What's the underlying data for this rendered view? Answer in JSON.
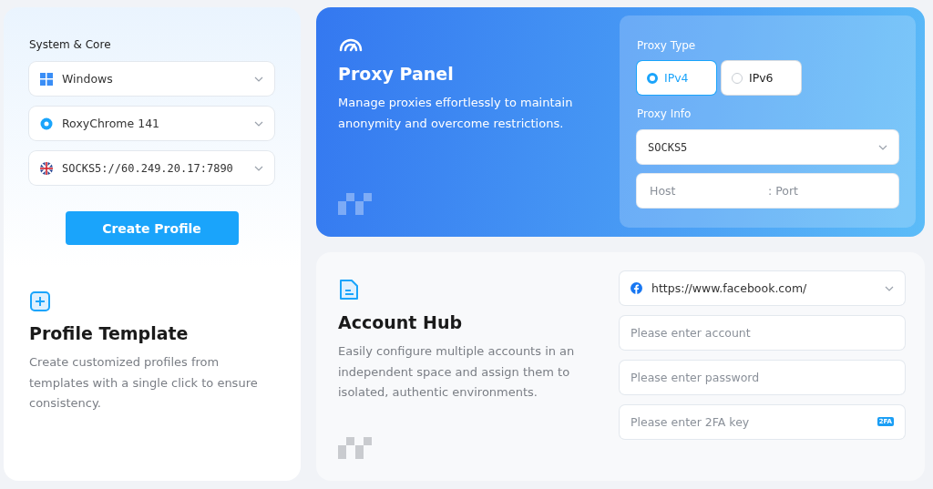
{
  "profile_card": {
    "section_label": "System & Core",
    "selects": [
      {
        "kind": "windows",
        "value": "Windows"
      },
      {
        "kind": "browser",
        "value": "RoxyChrome 141"
      },
      {
        "kind": "flag",
        "value": "SOCKS5://60.249.20.17:7890"
      }
    ],
    "button": "Create Profile",
    "title": "Profile Template",
    "description": "Create customized profiles from templates with a single click to ensure consistency."
  },
  "proxy_card": {
    "title": "Proxy Panel",
    "description": "Manage proxies effortlessly to maintain anonymity and overcome restrictions.",
    "type_label": "Proxy Type",
    "types": [
      {
        "label": "IPv4",
        "selected": true
      },
      {
        "label": "IPv6",
        "selected": false
      }
    ],
    "info_label": "Proxy Info",
    "protocol": "SOCKS5",
    "host_placeholder": "Host",
    "port_placeholder": ": Port"
  },
  "account_card": {
    "title": "Account Hub",
    "description": "Easily configure multiple accounts in an independent space and assign them to isolated, authentic environments.",
    "site": "https://www.facebook.com/",
    "fields": [
      {
        "kind": "text",
        "placeholder": "Please enter account"
      },
      {
        "kind": "text",
        "placeholder": "Please enter password"
      },
      {
        "kind": "twofa",
        "placeholder": "Please enter 2FA key",
        "badge": "2FA"
      }
    ]
  }
}
